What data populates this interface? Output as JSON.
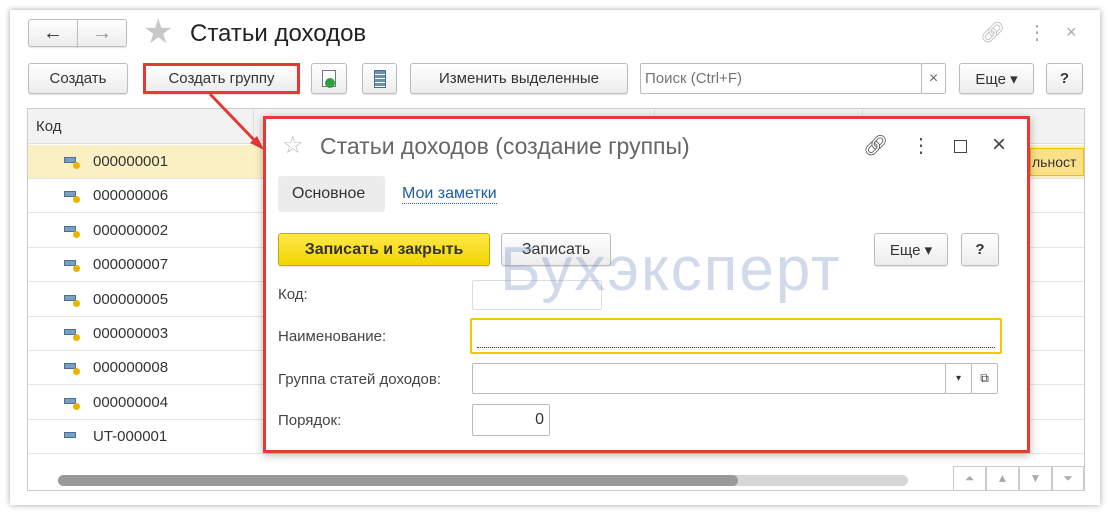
{
  "window": {
    "title": "Статьи доходов"
  },
  "toolbar": {
    "create": "Создать",
    "create_group": "Создать группу",
    "edit_selected": "Изменить выделенные",
    "search_placeholder": "Поиск (Ctrl+F)",
    "clear": "×",
    "more": "Еще ▾",
    "help": "?"
  },
  "table": {
    "columns": [
      "Код"
    ],
    "rows": [
      {
        "code": "000000001",
        "group": true
      },
      {
        "code": "000000006",
        "group": true
      },
      {
        "code": "000000002",
        "group": true
      },
      {
        "code": "000000007",
        "group": true
      },
      {
        "code": "000000005",
        "group": true
      },
      {
        "code": "000000003",
        "group": true
      },
      {
        "code": "000000008",
        "group": true
      },
      {
        "code": "000000004",
        "group": true
      },
      {
        "code": "UT-000001",
        "group": false
      }
    ],
    "selected_row_fragment": "льност"
  },
  "watermark": "Бухэксперт",
  "dialog": {
    "title": "Статьи доходов (создание группы)",
    "tabs": [
      "Основное",
      "Мои заметки"
    ],
    "save_close": "Записать и закрыть",
    "save": "Записать",
    "more": "Еще ▾",
    "help": "?",
    "fields": {
      "code_label": "Код:",
      "code_value": "",
      "name_label": "Наименование:",
      "name_value": "",
      "group_label": "Группа статей доходов:",
      "group_value": "",
      "order_label": "Порядок:",
      "order_value": "0"
    }
  },
  "colors": {
    "highlight": "#e53935",
    "primary_button": "#f5d800",
    "selected_row": "#fbf0c4"
  }
}
